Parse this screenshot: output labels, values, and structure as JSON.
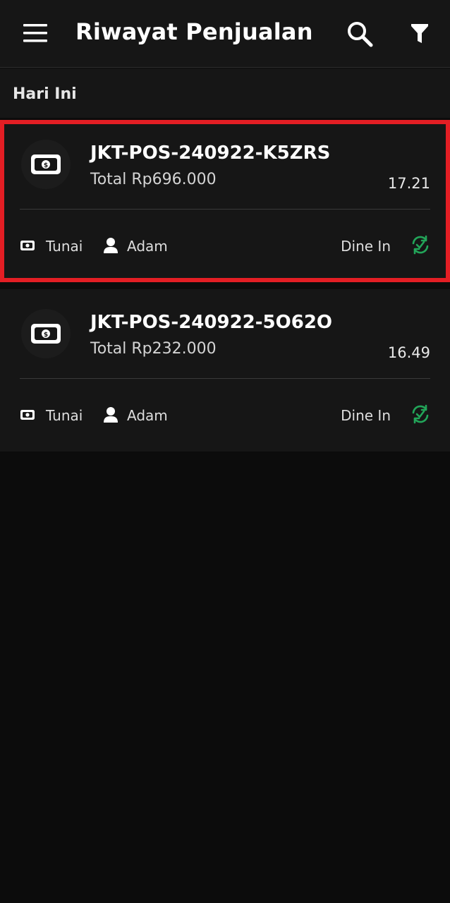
{
  "header": {
    "title": "Riwayat Penjualan",
    "menu_icon": "menu-icon",
    "search_icon": "search-icon",
    "filter_icon": "filter-icon"
  },
  "section": {
    "label": "Hari Ini"
  },
  "transactions": [
    {
      "id": "JKT-POS-240922-K5ZRS",
      "total": "Total Rp696.000",
      "time": "17.21",
      "payment": "Tunai",
      "cashier": "Adam",
      "order_type": "Dine In",
      "selected": true
    },
    {
      "id": "JKT-POS-240922-5O62O",
      "total": "Total Rp232.000",
      "time": "16.49",
      "payment": "Tunai",
      "cashier": "Adam",
      "order_type": "Dine In",
      "selected": false
    }
  ],
  "colors": {
    "background": "#0c0c0c",
    "surface": "#161616",
    "highlight": "#e31e24",
    "synced": "#22a559"
  }
}
